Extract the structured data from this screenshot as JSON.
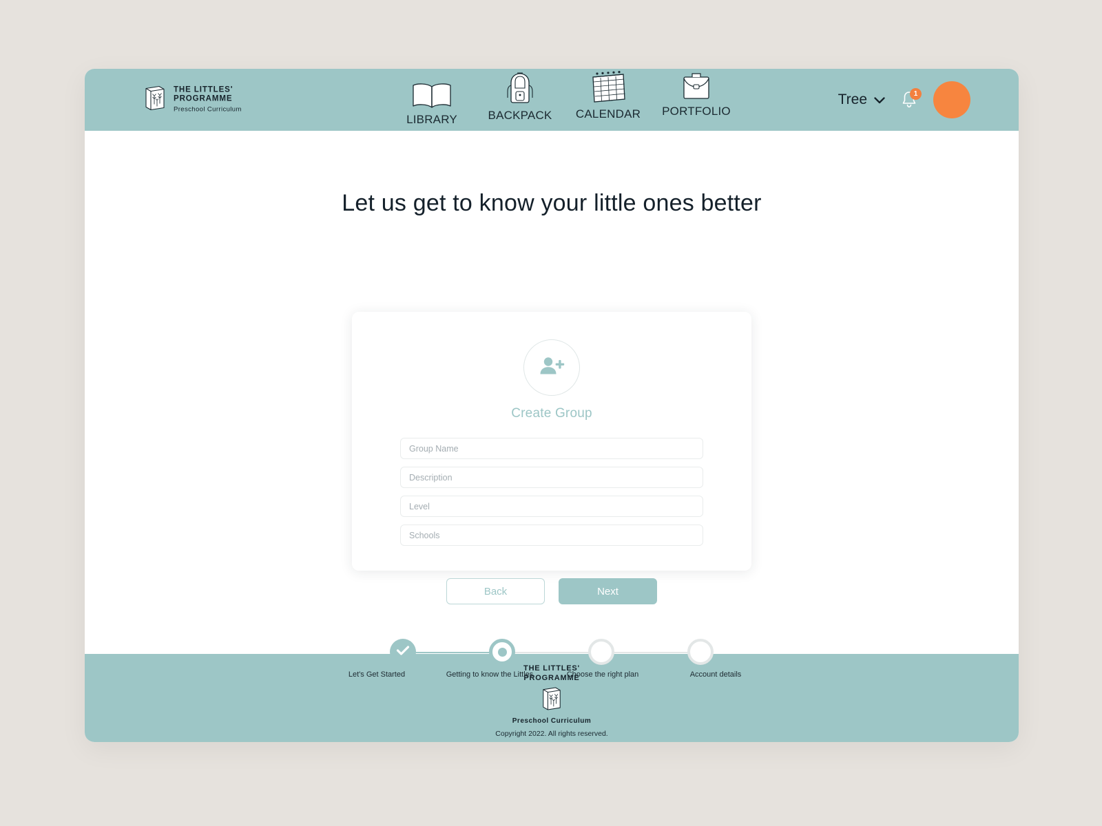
{
  "brand": {
    "title_line1": "THE LITTLES'",
    "title_line2": "PROGRAMME",
    "subtitle": "Preschool Curriculum",
    "book_icon": "book-logo-icon"
  },
  "header": {
    "background_color": "#9dc6c6",
    "nav": [
      {
        "label": "LIBRARY",
        "icon": "open-book-icon"
      },
      {
        "label": "BACKPACK",
        "icon": "backpack-icon"
      },
      {
        "label": "CALENDAR",
        "icon": "calendar-icon"
      },
      {
        "label": "PORTFOLIO",
        "icon": "briefcase-icon"
      }
    ],
    "account_name": "Tree",
    "chevron": "▾",
    "notification_icon": "bell-icon",
    "notification_count": "1",
    "notification_badge_color": "#f3803f",
    "avatar_color": "#f7853f"
  },
  "main": {
    "page_title": "Let us get to know your little ones better",
    "card": {
      "avatar_icon": "person-add-icon",
      "section_label": "Create Group",
      "accent_color": "#9dc6c6",
      "fields": [
        {
          "name": "group-name",
          "placeholder": "Group Name",
          "value": ""
        },
        {
          "name": "description",
          "placeholder": "Description",
          "value": ""
        },
        {
          "name": "level",
          "placeholder": "Level",
          "value": ""
        },
        {
          "name": "schools",
          "placeholder": "Schools",
          "value": ""
        }
      ]
    },
    "buttons": {
      "back": "Back",
      "next": "Next"
    },
    "stepper": {
      "steps": [
        {
          "label": "Let's Get Started",
          "state": "done"
        },
        {
          "label": "Getting to know the Littles",
          "state": "active"
        },
        {
          "label": "Choose the right plan",
          "state": "todo"
        },
        {
          "label": "Account details",
          "state": "todo"
        }
      ]
    }
  },
  "footer": {
    "title_line1": "THE LITTLES'",
    "title_line2": "PROGRAMME",
    "subtitle": "Preschool Curriculum",
    "copyright": "Copyright 2022. All rights reserved.",
    "background_color": "#9dc6c6"
  }
}
